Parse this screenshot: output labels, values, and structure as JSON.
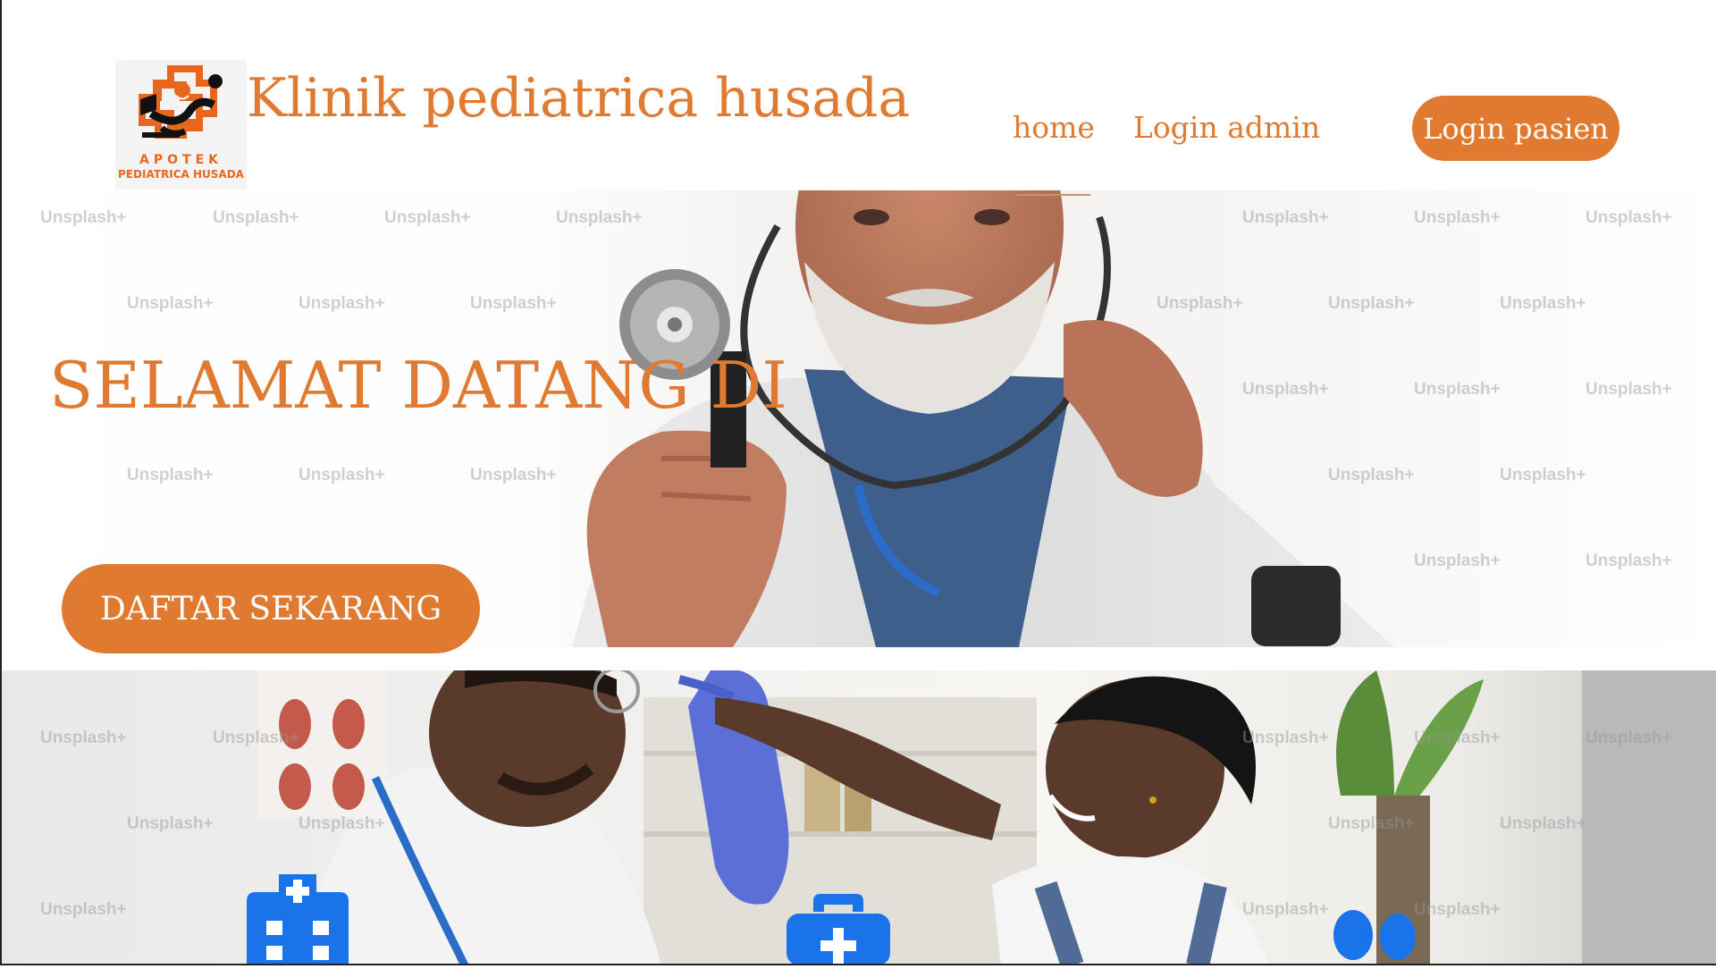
{
  "brand": {
    "logo_line1": "APOTEK",
    "logo_line2": "PEDIATRICA HUSADA",
    "title": "Klinik pediatrica husada",
    "primary_color": "#e07a30"
  },
  "nav": {
    "home_label": "home",
    "admin_label": "Login admin",
    "pasien_label": "Login pasien"
  },
  "hero": {
    "title": "SELAMAT DATANG DI",
    "cta_label": "DAFTAR SEKARANG",
    "watermark_text": "Unsplash+"
  },
  "features": {
    "icons": [
      "hospital-icon",
      "medical-kit-icon",
      "users-icon"
    ],
    "icon_color": "#1a73e8"
  }
}
